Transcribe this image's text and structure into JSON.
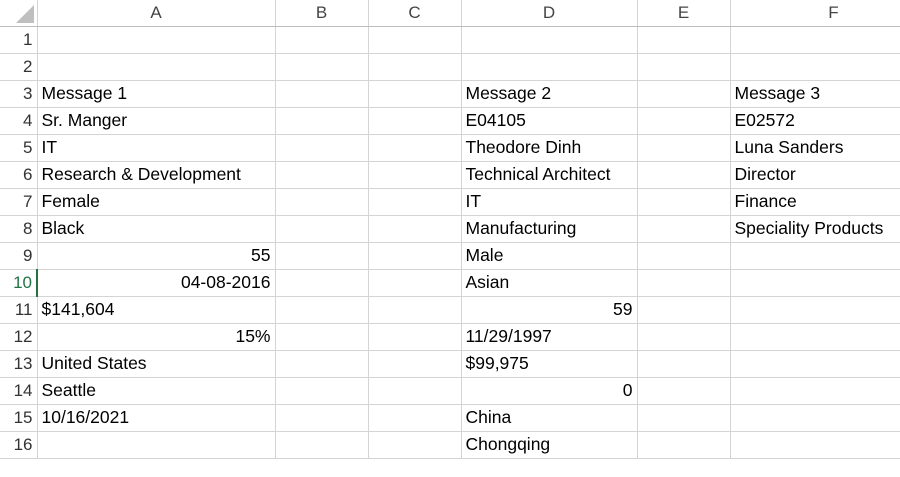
{
  "columns": [
    "A",
    "B",
    "C",
    "D",
    "E",
    "F"
  ],
  "rows": [
    {
      "num": "1",
      "A": "",
      "A_align": "left",
      "D": "",
      "D_align": "left",
      "F": ""
    },
    {
      "num": "2",
      "A": "",
      "A_align": "left",
      "D": "",
      "D_align": "left",
      "F": ""
    },
    {
      "num": "3",
      "A": "Message 1",
      "A_align": "left",
      "D": "Message 2",
      "D_align": "left",
      "F": "Message 3"
    },
    {
      "num": "4",
      "A": "Sr. Manger",
      "A_align": "left",
      "D": "E04105",
      "D_align": "left",
      "F": "E02572"
    },
    {
      "num": "5",
      "A": "IT",
      "A_align": "left",
      "D": "Theodore Dinh",
      "D_align": "left",
      "F": "Luna Sanders"
    },
    {
      "num": "6",
      "A": "Research & Development",
      "A_align": "left",
      "D": "Technical Architect",
      "D_align": "left",
      "F": "Director"
    },
    {
      "num": "7",
      "A": "Female",
      "A_align": "left",
      "D": "IT",
      "D_align": "left",
      "F": "Finance"
    },
    {
      "num": "8",
      "A": "Black",
      "A_align": "left",
      "D": "Manufacturing",
      "D_align": "left",
      "F": "Speciality Products"
    },
    {
      "num": "9",
      "A": "55",
      "A_align": "right",
      "D": "Male",
      "D_align": "left",
      "F": ""
    },
    {
      "num": "10",
      "A": "04-08-2016",
      "A_align": "right",
      "D": "Asian",
      "D_align": "left",
      "F": ""
    },
    {
      "num": "11",
      "A": "$141,604",
      "A_align": "left",
      "D": "59",
      "D_align": "right",
      "F": ""
    },
    {
      "num": "12",
      "A": "15%",
      "A_align": "right",
      "D": "11/29/1997",
      "D_align": "left",
      "F": ""
    },
    {
      "num": "13",
      "A": "United States",
      "A_align": "left",
      "D": "$99,975",
      "D_align": "left",
      "F": ""
    },
    {
      "num": "14",
      "A": "Seattle",
      "A_align": "left",
      "D": "0",
      "D_align": "right",
      "F": ""
    },
    {
      "num": "15",
      "A": "10/16/2021",
      "A_align": "left",
      "D": "China",
      "D_align": "left",
      "F": ""
    },
    {
      "num": "16",
      "A": "",
      "A_align": "left",
      "D": "Chongqing",
      "D_align": "left",
      "F": ""
    }
  ],
  "active_row": "10",
  "colors": {
    "gridline": "#d4d4d4",
    "header_border": "#bdbdbd",
    "active_accent": "#217346"
  }
}
